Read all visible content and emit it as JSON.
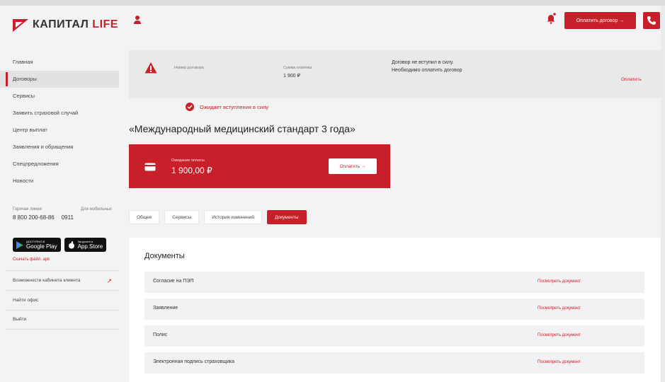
{
  "brand": {
    "name_main": "КАПИТАЛ ",
    "name_accent": "LIFE",
    "accent_color": "#c8202b"
  },
  "sidebar": {
    "items": [
      {
        "label": "Главная",
        "active": false
      },
      {
        "label": "Договоры",
        "active": true
      },
      {
        "label": "Сервисы",
        "active": false
      },
      {
        "label": "Заявить страховой случай",
        "active": false
      },
      {
        "label": "Центр выплат",
        "active": false
      },
      {
        "label": "Заявления и обращения",
        "active": false
      },
      {
        "label": "Спецпредложения",
        "active": false
      },
      {
        "label": "Новости",
        "active": false
      }
    ],
    "hotline_label": "Горячая линия",
    "mobile_label": "Для мобильных",
    "hotline_number": "8 800 200-68-86",
    "mobile_number": "0911",
    "google_play_small": "ДОСТУПНО В",
    "google_play": "Google Play",
    "app_store_small": "Загрузите в",
    "app_store": "App Store",
    "apk_link": "Скачать файл .apk",
    "features_link": "Возможности кабинета клиента",
    "find_office": "Найти офис",
    "logout": "Выйти"
  },
  "header": {
    "pay_button": "Оплатить договор →"
  },
  "banner": {
    "contract_number_label": "Номер договора",
    "payment_sum_label": "Сумма платежа",
    "payment_sum_value": "1 900 ₽",
    "message": "Договор не вступил в силу. Необходимо оплатить договор",
    "pay_link": "Оплатить"
  },
  "status": {
    "text": "Ожидает вступления в силу"
  },
  "contract": {
    "title": "«Международный медицинский стандарт 3 года»"
  },
  "payment_card": {
    "label": "Ожидание оплаты",
    "amount": "1 900,00 ₽",
    "pay_button": "Оплатить →"
  },
  "tabs": [
    {
      "label": "Общее",
      "active": false
    },
    {
      "label": "Сервисы",
      "active": false
    },
    {
      "label": "История изменений",
      "active": false
    },
    {
      "label": "Документы",
      "active": true
    }
  ],
  "documents": {
    "title": "Документы",
    "link_label": "Посмотреть документ",
    "rows": [
      {
        "name": "Согласие на ПЭП"
      },
      {
        "name": "Заявление"
      },
      {
        "name": "Полис"
      },
      {
        "name": "Электронная подпись страховщика"
      }
    ]
  }
}
